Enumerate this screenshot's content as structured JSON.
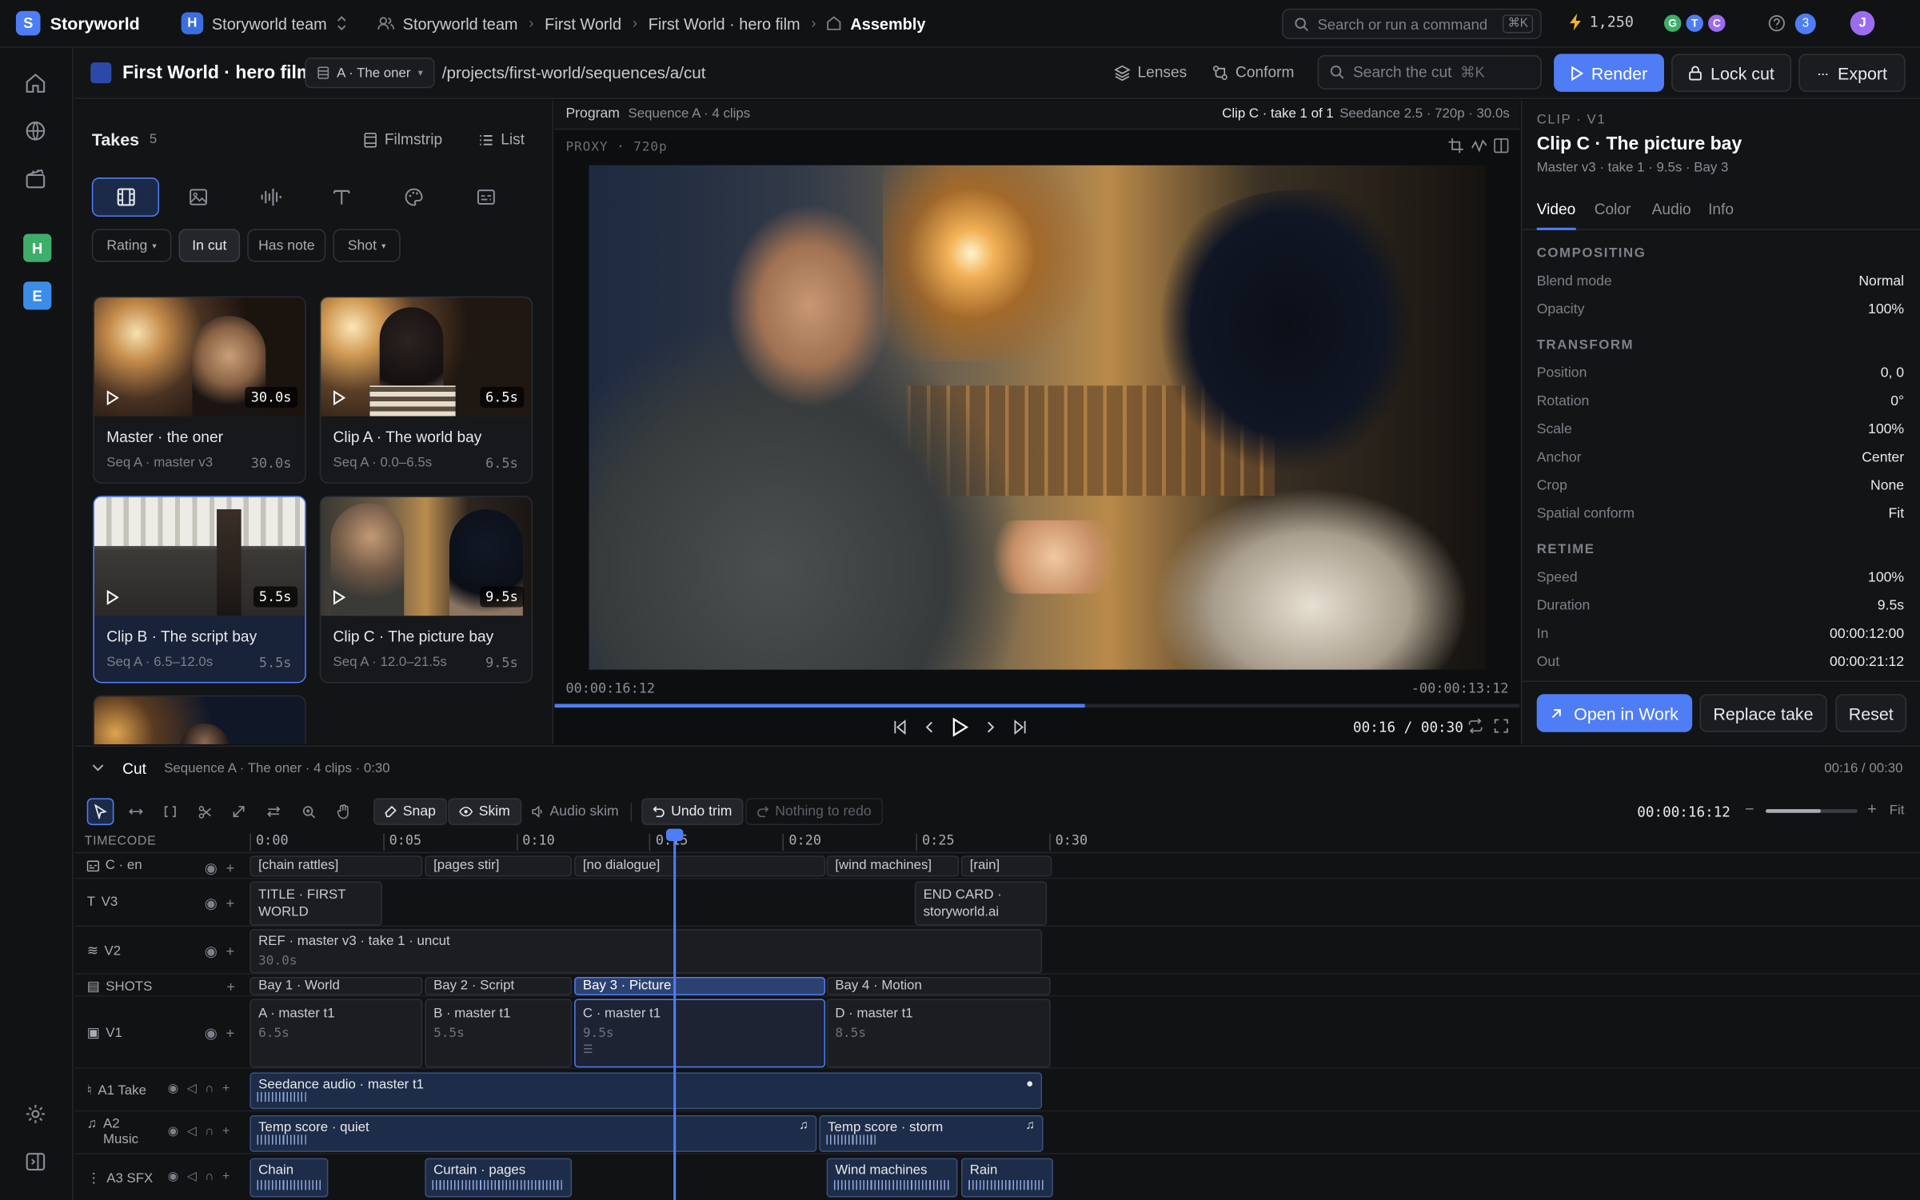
{
  "topbar": {
    "brand": "Storyworld",
    "brand_letter": "S",
    "team_letter": "H",
    "team": "Storyworld team",
    "breadcrumbs": [
      "Storyworld team",
      "First World",
      "First World · hero film",
      "Assembly"
    ],
    "search_placeholder": "Search or run a command",
    "search_kbd": "⌘K",
    "credits": "1,250",
    "collaborators": [
      "G",
      "T",
      "C"
    ],
    "collab_colors": [
      "#3fae6b",
      "#4f7df5",
      "#9b6cf0"
    ],
    "notifications": "3",
    "user": "J"
  },
  "rail": {
    "workspaces": [
      {
        "letter": "H",
        "color": "#3fae6b"
      },
      {
        "letter": "E",
        "color": "#3b8de8"
      }
    ]
  },
  "project": {
    "title": "First World · hero film",
    "sequence_select": "A · The oner",
    "path": "/projects/first-world/sequences/a/cut",
    "lenses": "Lenses",
    "conform": "Conform",
    "search_placeholder": "Search the cut",
    "search_kbd": "⌘K",
    "render": "Render",
    "lock": "Lock cut",
    "export": "Export"
  },
  "takes": {
    "title": "Takes",
    "count": "5",
    "filmstrip": "Filmstrip",
    "list": "List",
    "filters": [
      "Rating",
      "In cut",
      "Has note",
      "Shot"
    ],
    "cards": [
      {
        "title": "Master · the oner",
        "meta": "Seq A · master v3",
        "dur": "30.0s",
        "badge": "30.0s"
      },
      {
        "title": "Clip A · The world bay",
        "meta": "Seq A · 0.0–6.5s",
        "dur": "6.5s",
        "badge": "6.5s"
      },
      {
        "title": "Clip B · The script bay",
        "meta": "Seq A · 6.5–12.0s",
        "dur": "5.5s",
        "badge": "5.5s"
      },
      {
        "title": "Clip C · The picture bay",
        "meta": "Seq A · 12.0–21.5s",
        "dur": "9.5s",
        "badge": "9.5s"
      }
    ]
  },
  "program": {
    "label": "Program",
    "sequence": "Sequence A · 4 clips",
    "clip": "Clip C · take 1 of 1",
    "model": "Seedance 2.5 · 720p · 30.0s",
    "proxy": "PROXY · 720p",
    "tc_in": "00:00:16:12",
    "tc_remaining": "-00:00:13:12",
    "time": "00:16 / 00:30",
    "progress": 0.55
  },
  "inspector": {
    "kicker": "CLIP · V1",
    "title": "Clip C · The picture bay",
    "subtitle": "Master v3 · take 1 · 9.5s · Bay 3",
    "tabs": [
      "Video",
      "Color",
      "Audio",
      "Info"
    ],
    "compositing_title": "COMPOSITING",
    "compositing": [
      {
        "k": "Blend mode",
        "v": "Normal"
      },
      {
        "k": "Opacity",
        "v": "100%"
      }
    ],
    "transform_title": "TRANSFORM",
    "transform": [
      {
        "k": "Position",
        "v": "0, 0"
      },
      {
        "k": "Rotation",
        "v": "0°"
      },
      {
        "k": "Scale",
        "v": "100%"
      },
      {
        "k": "Anchor",
        "v": "Center"
      },
      {
        "k": "Crop",
        "v": "None"
      },
      {
        "k": "Spatial conform",
        "v": "Fit"
      }
    ],
    "retime_title": "RETIME",
    "retime": [
      {
        "k": "Speed",
        "v": "100%"
      },
      {
        "k": "Duration",
        "v": "9.5s"
      },
      {
        "k": "In",
        "v": "00:00:12:00"
      },
      {
        "k": "Out",
        "v": "00:00:21:12"
      }
    ],
    "open_work": "Open in Work",
    "replace": "Replace take",
    "reset": "Reset"
  },
  "timeline": {
    "title": "Cut",
    "subtitle": "Sequence A · The oner · 4 clips · 0:30",
    "time": "00:16 / 00:30",
    "snap": "Snap",
    "skim": "Skim",
    "audio_skim": "Audio skim",
    "undo": "Undo trim",
    "redo": "Nothing to redo",
    "timecode": "00:00:16:12",
    "fit": "Fit",
    "timecode_label": "TIMECODE",
    "ticks": [
      "0:00",
      "0:05",
      "0:10",
      "0:15",
      "0:20",
      "0:25",
      "0:30"
    ],
    "tracks": {
      "captions": "C · en",
      "v3": "V3",
      "v2": "V2",
      "shots": "SHOTS",
      "v1": "V1",
      "a1": "A1 Take",
      "a2": "A2 Music",
      "a3": "A3 SFX"
    },
    "captions": [
      "[chain rattles]",
      "[pages stir]",
      "[no dialogue]",
      "[wind machines]",
      "[rain]"
    ],
    "v3": [
      "TITLE · FIRST WORLD",
      "END CARD · storyworld.ai"
    ],
    "v2": {
      "label": "REF · master v3 · take 1 · uncut",
      "dur": "30.0s"
    },
    "shots": [
      "Bay 1 · World",
      "Bay 2 · Script",
      "Bay 3 · Picture",
      "Bay 4 · Motion"
    ],
    "v1": [
      {
        "label": "A · master t1",
        "dur": "6.5s"
      },
      {
        "label": "B · master t1",
        "dur": "5.5s"
      },
      {
        "label": "C · master t1",
        "dur": "9.5s"
      },
      {
        "label": "D · master t1",
        "dur": "8.5s"
      }
    ],
    "a1": "Seedance audio · master t1",
    "a2": [
      "Temp score · quiet",
      "Temp score · storm"
    ],
    "a3": [
      "Chain",
      "Curtain · pages",
      "Wind machines",
      "Rain"
    ]
  }
}
